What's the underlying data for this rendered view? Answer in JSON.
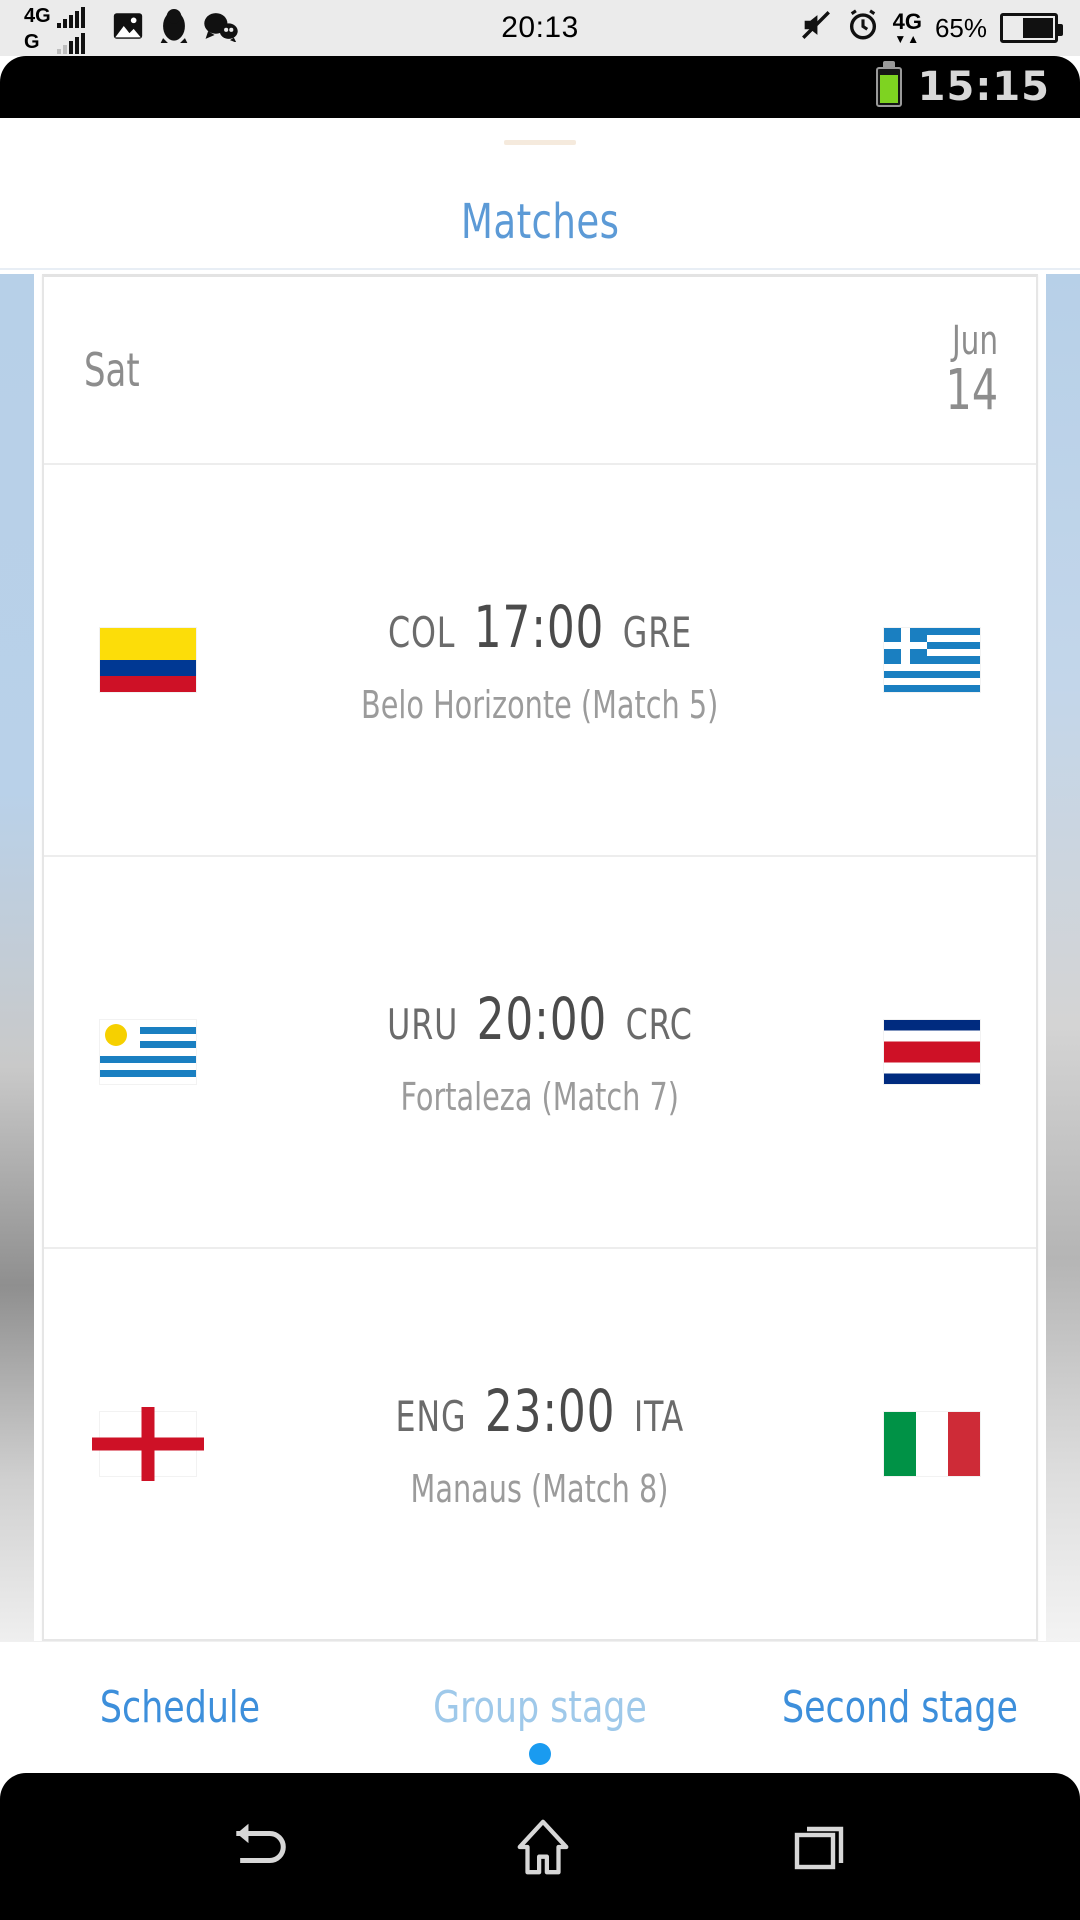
{
  "host_status": {
    "network_primary": "4G",
    "network_secondary": "G",
    "clock": "20:13",
    "network_right": "4G",
    "battery_percent": "65%",
    "icons": [
      "photo-icon",
      "penguin-icon",
      "chat-icon",
      "mute-icon",
      "alarm-icon"
    ]
  },
  "inner_status": {
    "clock": "15:15",
    "battery": "battery-full-icon"
  },
  "app": {
    "title": "Matches",
    "accent_color": "#5c9ad6"
  },
  "schedule": {
    "date": {
      "weekday": "Sat",
      "month": "Jun",
      "day": "14"
    },
    "matches": [
      {
        "home": "COL",
        "time": "17:00",
        "away": "GRE",
        "venue": "Belo Horizonte (Match  5)",
        "home_flag": "colombia-flag",
        "away_flag": "greece-flag"
      },
      {
        "home": "URU",
        "time": "20:00",
        "away": "CRC",
        "venue": "Fortaleza (Match  7)",
        "home_flag": "uruguay-flag",
        "away_flag": "costa-rica-flag"
      },
      {
        "home": "ENG",
        "time": "23:00",
        "away": "ITA",
        "venue": "Manaus (Match  8)",
        "home_flag": "england-flag",
        "away_flag": "italy-flag"
      }
    ]
  },
  "tabs": [
    {
      "label": "Schedule",
      "active": true
    },
    {
      "label": "Group stage",
      "active": false
    },
    {
      "label": "Second stage",
      "active": true
    }
  ],
  "navbar": {
    "back": "back-icon",
    "home": "home-icon",
    "recents": "recents-icon"
  }
}
